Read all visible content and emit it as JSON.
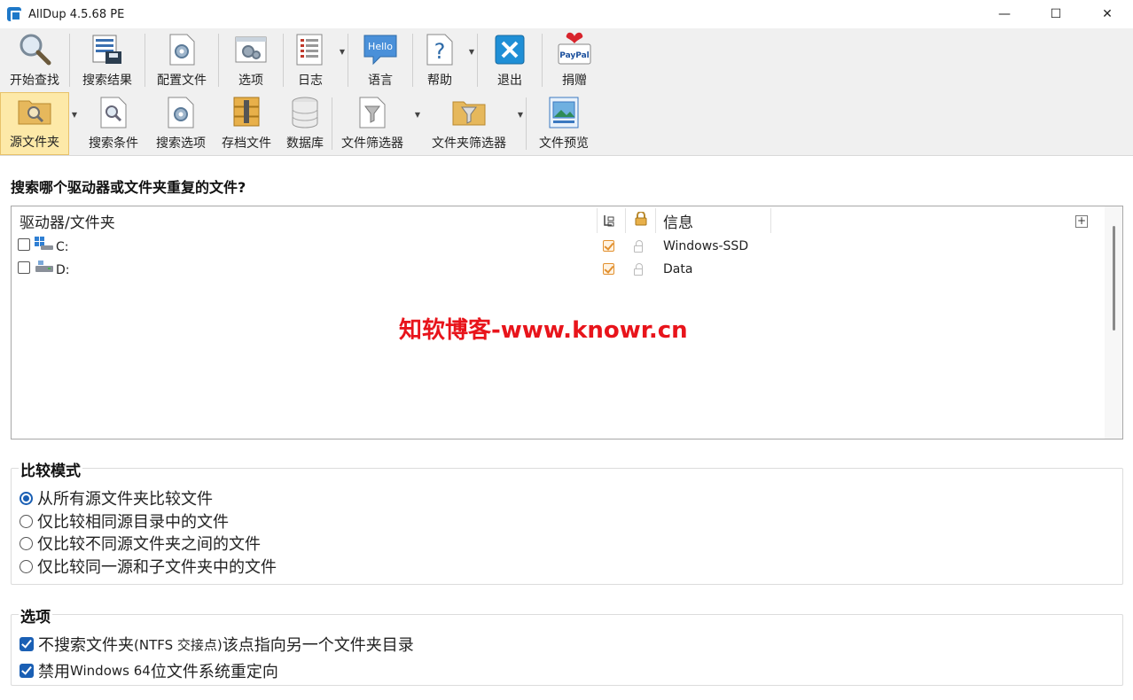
{
  "window": {
    "title": "AllDup 4.5.68 PE",
    "minimize": "—",
    "maximize": "☐",
    "close": "✕"
  },
  "toolbar1": {
    "items": [
      {
        "label": "开始查找",
        "icon": "magnifier-icon"
      },
      {
        "label": "搜索结果",
        "icon": "results-icon"
      },
      {
        "label": "配置文件",
        "icon": "profile-icon"
      },
      {
        "label": "选项",
        "icon": "options-icon"
      },
      {
        "label": "日志",
        "icon": "log-icon"
      },
      {
        "label": "语言",
        "icon": "hello-icon",
        "icon_text": "Hello"
      },
      {
        "label": "帮助",
        "icon": "help-icon"
      },
      {
        "label": "退出",
        "icon": "exit-icon"
      },
      {
        "label": "捐赠",
        "icon": "paypal-icon",
        "icon_text": "PayPal"
      }
    ]
  },
  "toolbar2": {
    "items": [
      {
        "label": "源文件夹",
        "icon": "source-folder-icon",
        "active": true
      },
      {
        "label": "搜索条件",
        "icon": "search-criteria-icon"
      },
      {
        "label": "搜索选项",
        "icon": "search-options-icon"
      },
      {
        "label": "存档文件",
        "icon": "archive-icon"
      },
      {
        "label": "数据库",
        "icon": "database-icon"
      },
      {
        "label": "文件筛选器",
        "icon": "file-filter-icon"
      },
      {
        "label": "文件夹筛选器",
        "icon": "folder-filter-icon"
      },
      {
        "label": "文件预览",
        "icon": "file-preview-icon"
      }
    ]
  },
  "main": {
    "question": "搜索哪个驱动器或文件夹重复的文件?",
    "drive_table": {
      "col_drive": "驱动器/文件夹",
      "col_info": "信息",
      "plus": "+",
      "rows": [
        {
          "drive": "C:",
          "info": "Windows-SSD",
          "checked": false
        },
        {
          "drive": "D:",
          "info": "Data",
          "checked": false
        }
      ]
    },
    "watermark": "知软博客-www.knowr.cn"
  },
  "compare_mode": {
    "title": "比较模式",
    "options": [
      {
        "label": "从所有源文件夹比较文件",
        "selected": true
      },
      {
        "label": "仅比较相同源目录中的文件",
        "selected": false
      },
      {
        "label": "仅比较不同源文件夹之间的文件",
        "selected": false
      },
      {
        "label": "仅比较同一源和子文件夹中的文件",
        "selected": false
      }
    ]
  },
  "options": {
    "title": "选项",
    "items": [
      {
        "pre": "不搜索文件夹 ",
        "small": "(NTFS 交接点)",
        "post": " 该点指向另一个文件夹目录",
        "checked": true
      },
      {
        "pre": "禁用 ",
        "small": "Windows 64",
        "post": " 位文件系统重定向",
        "checked": true
      }
    ]
  },
  "colors": {
    "accent": "#1a5fb4",
    "toolbar_bg": "#f0f0f0",
    "active_tool": "#fde9a8",
    "watermark": "#e8141b",
    "check_orange": "#e2902f"
  }
}
